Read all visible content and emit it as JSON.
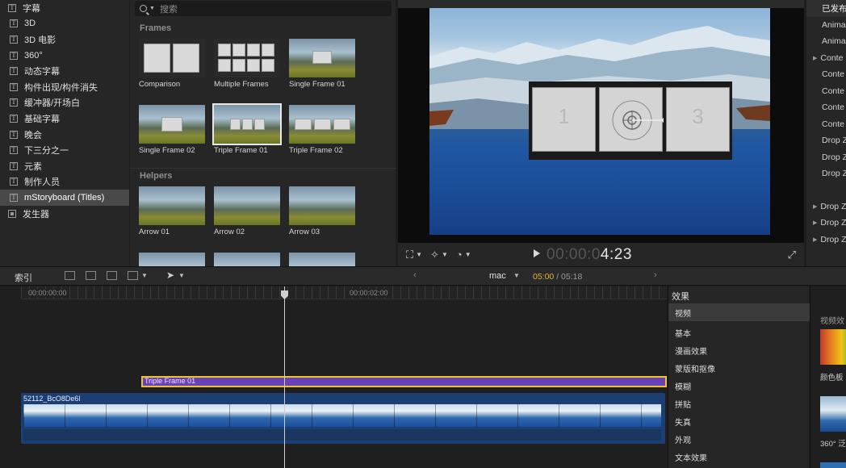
{
  "sidebar": {
    "items": [
      {
        "label": "字幕",
        "icon": "text-icon",
        "level": "parent"
      },
      {
        "label": "3D",
        "icon": "text-icon"
      },
      {
        "label": "3D 电影",
        "icon": "text-icon"
      },
      {
        "label": "360°",
        "icon": "text-icon"
      },
      {
        "label": "动态字幕",
        "icon": "text-icon"
      },
      {
        "label": "构件出现/构件消失",
        "icon": "text-icon"
      },
      {
        "label": "缓冲器/开场白",
        "icon": "text-icon"
      },
      {
        "label": "基础字幕",
        "icon": "text-icon"
      },
      {
        "label": "晚会",
        "icon": "text-icon"
      },
      {
        "label": "下三分之一",
        "icon": "text-icon"
      },
      {
        "label": "元素",
        "icon": "text-icon"
      },
      {
        "label": "制作人员",
        "icon": "text-icon"
      },
      {
        "label": "mStoryboard (Titles)",
        "icon": "text-icon",
        "selected": true
      },
      {
        "label": "发生器",
        "icon": "generator-icon",
        "level": "parent"
      }
    ]
  },
  "browser": {
    "search_placeholder": "搜索",
    "sections": [
      {
        "title": "Frames",
        "items": [
          "Comparison",
          "Multiple Frames",
          "Single Frame 01",
          "Single Frame 02",
          "Triple Frame 01",
          "Triple Frame 02"
        ]
      },
      {
        "title": "Helpers",
        "items": [
          "Arrow 01",
          "Arrow 02",
          "Arrow 03"
        ]
      }
    ]
  },
  "viewer": {
    "panel_numbers": [
      "1",
      "3"
    ],
    "timecode_dim": "00:00:0",
    "timecode_live": "4:23"
  },
  "inspector": {
    "items": [
      "已发布",
      "Anima",
      "Anima",
      "Conte",
      "Conte",
      "Conte",
      "Conte",
      "Conte",
      "Drop Z",
      "Drop Z",
      "Drop Z",
      "Drop Z",
      "Drop Z",
      "Drop Z"
    ]
  },
  "timeline_toolbar": {
    "index_label": "索引",
    "project_name": "mac",
    "current_time": "05:00",
    "total_time": "/ 05:18"
  },
  "timeline": {
    "ruler_labels": [
      "00:00:00:00",
      "00:00:02:00"
    ],
    "title_clip_label": "Triple Frame 01",
    "video_clip_label": "52112_BcO8De6l"
  },
  "effects": {
    "header": "效果",
    "categories": [
      "视频",
      "基本",
      "漫画效果",
      "蒙版和抠像",
      "模糊",
      "拼贴",
      "失真",
      "外观",
      "文本效果"
    ],
    "gallery_header": "视频效",
    "gallery_items": [
      "颜色板",
      "360° 泛"
    ]
  }
}
